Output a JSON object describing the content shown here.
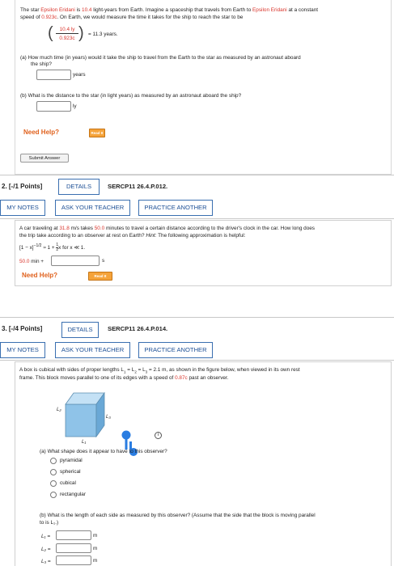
{
  "q1": {
    "intro_a": "The star ",
    "star_name": "Epsilon Eridani",
    "intro_b": " is ",
    "distance": "10.4",
    "intro_c": " light-years from Earth. Imagine a spaceship that travels from Earth to ",
    "star_name2": "Epsilon Eridani",
    "intro_d": " at a constant",
    "intro_line2_a": "speed of ",
    "speed": "0.923c",
    "intro_line2_b": ". On Earth, we would measure the time it takes for the ship to reach the star to be",
    "frac_num": "10.4 ly",
    "frac_den": "0.923c",
    "frac_result": "= 11.3 years.",
    "part_a_line1": "(a)  How much time (in years) would it take the ship to travel from the Earth to the star as measured by an astronaut aboard",
    "part_a_line2": "the ship?",
    "part_a_unit": "years",
    "part_b": "(b)  What is the distance to the star (in light years) as measured by an astronaut aboard the ship?",
    "part_b_unit": "ly",
    "need_help": "Need Help?",
    "read_it": "Read It",
    "submit": "Submit Answer"
  },
  "q2": {
    "points": "2.  [-/1 Points]",
    "details": "DETAILS",
    "code": "SERCP11 26.4.P.012.",
    "my_notes": "MY NOTES",
    "ask_teacher": "ASK YOUR TEACHER",
    "practice": "PRACTICE ANOTHER",
    "text1_a": "A car traveling at ",
    "speed": "31.8",
    "text1_b": " m/s takes ",
    "minutes": "50.0",
    "text1_c": " minutes to travel a certain distance according to the driver's clock in the car. How long does",
    "text2_a": "the trip take according to an observer at rest on Earth? ",
    "hint_label": "Hint:",
    "text2_b": " The following approximation is helpful:",
    "formula_left": "[1 − x]",
    "formula_exp": "−1/2",
    "formula_mid": " ≈ 1 + ",
    "formula_frac_num": "1",
    "formula_frac_den": "2",
    "formula_right": "x for x ≪ 1.",
    "answer_prefix_val": "50.0",
    "answer_prefix_unit": " min +",
    "answer_unit": "s",
    "need_help": "Need Help?",
    "read_it": "Read It"
  },
  "q3": {
    "points": "3.  [-/4 Points]",
    "details": "DETAILS",
    "code": "SERCP11 26.4.P.014.",
    "my_notes": "MY NOTES",
    "ask_teacher": "ASK YOUR TEACHER",
    "practice": "PRACTICE ANOTHER",
    "text1_a": "A box is cubical with sides of proper lengths L",
    "text1_sub": "1",
    "text1_b": " = L",
    "text1_sub2": "2",
    "text1_c": " = L",
    "text1_sub3": "3",
    "text1_d": " = 2.1 m, as shown in the figure below, when viewed in its own rest",
    "text2_a": "frame. This block moves parallel to one of its edges with a speed of ",
    "speed": "0.87c",
    "text2_b": " past an observer.",
    "fig_l1": "L₁",
    "fig_l2": "L₂",
    "fig_l3": "L₃",
    "part_a": "(a) What shape does it appear to have to this observer?",
    "options": [
      "pyramidal",
      "spherical",
      "cubical",
      "rectangular"
    ],
    "part_b_line1": "(b) What is the length of each side as measured by this observer? (Assume that the side that the block is moving parallel",
    "part_b_line2": "to is L₁.)",
    "l_labels": [
      "L₁ =",
      "L₂ =",
      "L₃ ="
    ],
    "l_unit": "m",
    "info_icon_label": "i"
  },
  "colors": {
    "accent_red": "#d9342b",
    "button_blue": "#1c4f95",
    "help_orange": "#e0611d",
    "cube_blue": "#8fc3e8",
    "cursor_blue": "#2a7de1"
  }
}
